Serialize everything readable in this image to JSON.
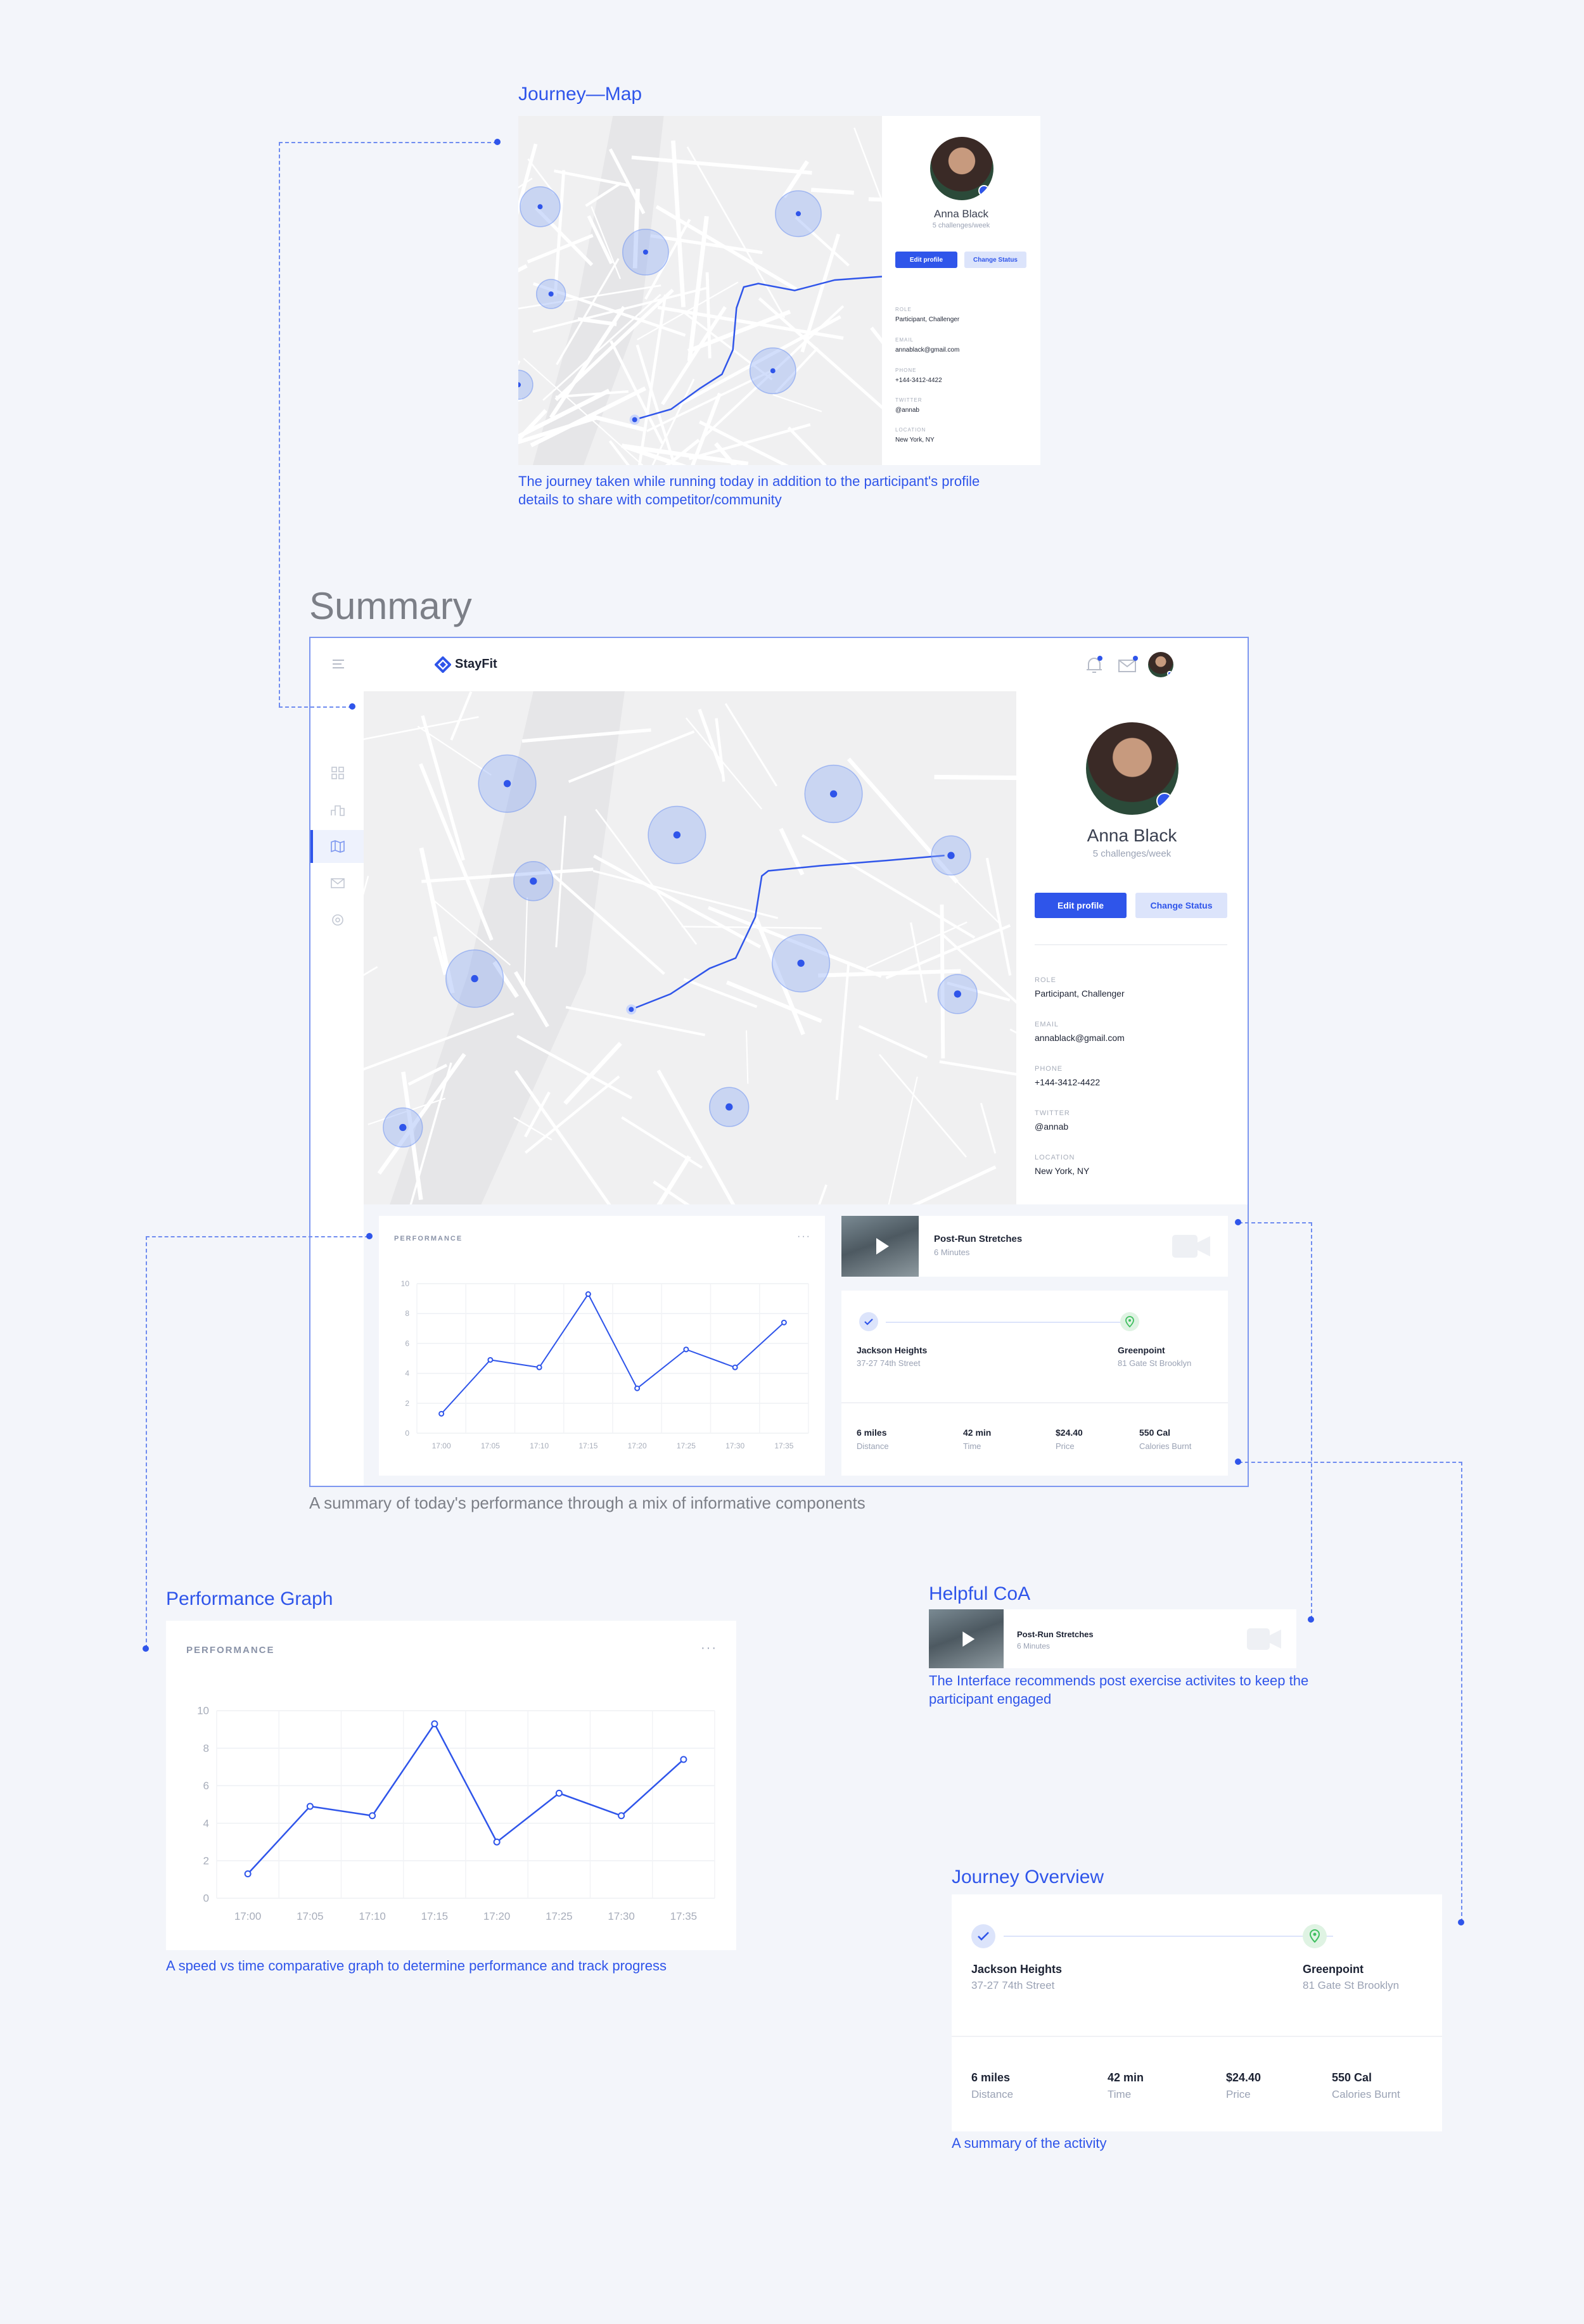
{
  "sections": {
    "journey_map": {
      "title": "Journey—Map",
      "caption": "The journey taken while running today in addition to the participant's profile details to share with competitor/community"
    },
    "summary": {
      "title": "Summary",
      "caption": "A summary of  today's performance through a mix of informative components"
    },
    "performance_graph": {
      "title": "Performance Graph",
      "caption": "A speed vs time comparative graph to determine performance and track progress"
    },
    "helpful_coa": {
      "title": "Helpful CoA",
      "caption": "The Interface recommends post exercise activites to keep the participant engaged"
    },
    "journey_overview": {
      "title": "Journey Overview",
      "caption": "A summary of the activity"
    }
  },
  "app": {
    "brand": "StayFit",
    "icons": {
      "menu": "menu-icon",
      "bell": "bell-icon",
      "mail": "mail-icon",
      "nav": [
        "grid-icon",
        "podium-icon",
        "map-icon",
        "mail-icon",
        "settings-icon"
      ]
    }
  },
  "profile": {
    "name": "Anna Black",
    "subtitle": "5 challenges/week",
    "edit_label": "Edit profile",
    "status_label": "Change Status",
    "fields": {
      "role_label": "ROLE",
      "role": "Participant, Challenger",
      "email_label": "EMAIL",
      "email": "annablack@gmail.com",
      "phone_label": "PHONE",
      "phone": "+144-3412-4422",
      "twitter_label": "TWITTER",
      "twitter": "@annab",
      "location_label": "LOCATION",
      "location": "New York, NY"
    }
  },
  "performance": {
    "label": "PERFORMANCE",
    "more": "···"
  },
  "video": {
    "title": "Post-Run Stretches",
    "duration": "6 Minutes"
  },
  "journey": {
    "start_name": "Jackson Heights",
    "start_address": "37-27 74th Street",
    "end_name": "Greenpoint",
    "end_address": "81 Gate St Brooklyn",
    "stats": [
      {
        "value": "6 miles",
        "label": "Distance"
      },
      {
        "value": "42 min",
        "label": "Time"
      },
      {
        "value": "$24.40",
        "label": "Price"
      },
      {
        "value": "550 Cal",
        "label": "Calories Burnt"
      }
    ]
  },
  "chart_data": {
    "type": "line",
    "title": "PERFORMANCE",
    "x": [
      "17:00",
      "17:05",
      "17:10",
      "17:15",
      "17:20",
      "17:25",
      "17:30",
      "17:35"
    ],
    "values": [
      1.3,
      4.9,
      4.4,
      9.3,
      3.0,
      5.6,
      4.4,
      7.4
    ],
    "yticks": [
      0,
      2,
      4,
      6,
      8,
      10
    ],
    "ylim": [
      0,
      10
    ],
    "grid": true,
    "color": "#2f55ea"
  },
  "colors": {
    "accent": "#2f55ea",
    "soft": "#dce4fb",
    "background": "#f3f5fa",
    "green": "#3fbf5f"
  }
}
